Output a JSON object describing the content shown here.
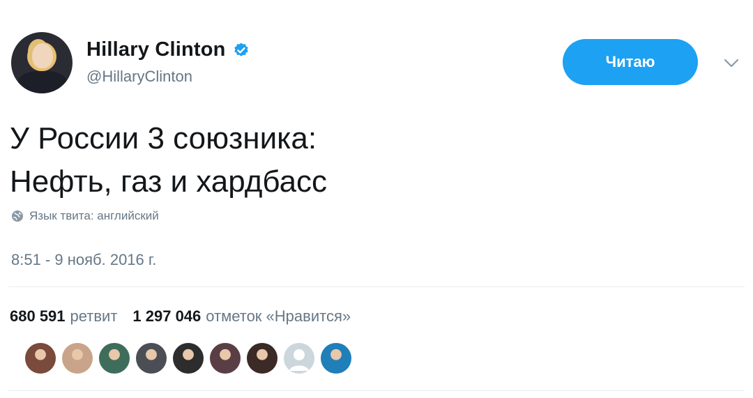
{
  "author": {
    "name": "Hillary Clinton",
    "handle": "@HillaryClinton",
    "avatar_icon": "profile-photo"
  },
  "follow_button": {
    "label": "Читаю",
    "color": "#1da1f2"
  },
  "tweet": {
    "lines": [
      "У России 3 союзника:",
      "Нефть, газ и хардбасс"
    ],
    "language_label": "Язык твита: английский",
    "timestamp": "8:51 - 9 нояб. 2016 г."
  },
  "stats": {
    "retweets_count": "680 591",
    "retweets_label": "ретвит",
    "likes_count": "1 297 046",
    "likes_label": "отметок «Нравится»"
  },
  "likers": [
    {
      "icon": "user-avatar",
      "color": "#7a4a3c"
    },
    {
      "icon": "user-avatar",
      "color": "#c9a48a"
    },
    {
      "icon": "user-avatar",
      "color": "#3f6d5b"
    },
    {
      "icon": "user-avatar",
      "color": "#4b4f55"
    },
    {
      "icon": "user-avatar",
      "color": "#2d2d2d"
    },
    {
      "icon": "user-avatar",
      "color": "#5a3e46"
    },
    {
      "icon": "user-avatar",
      "color": "#3b2a25"
    },
    {
      "icon": "default-avatar",
      "color": "#ccd6dd"
    },
    {
      "icon": "user-avatar",
      "color": "#1f7fb8"
    }
  ],
  "colors": {
    "text": "#14171a",
    "secondary": "#657786",
    "divider": "#e6ecf0",
    "accent": "#1da1f2"
  }
}
